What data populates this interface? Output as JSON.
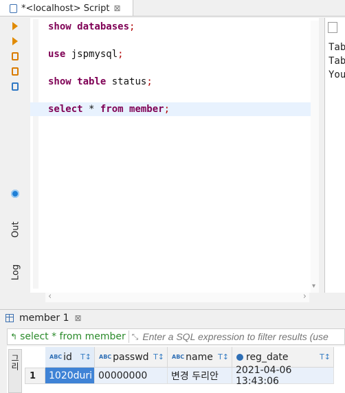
{
  "editor_tab": {
    "title": "*<localhost> Script",
    "close": "⊠"
  },
  "editor": {
    "lines": [
      {
        "kw": "show databases",
        "rest": "",
        "semi": ";"
      },
      {
        "kw": "use",
        "rest": " jspmysql",
        "semi": ";"
      },
      {
        "kw": "show table",
        "rest": " status",
        "semi": ";"
      },
      {
        "kw": "select",
        "rest": " * ",
        "kw2": "from member",
        "semi": ";"
      }
    ]
  },
  "side_tabs": {
    "out": "Out",
    "log": "Log"
  },
  "right_panel": {
    "lines": [
      "Tab",
      "Tab",
      "You"
    ]
  },
  "results_tab": {
    "title": "member 1",
    "close": "⊠"
  },
  "filter": {
    "query": "select * from member",
    "placeholder": "Enter a SQL expression to filter results (use"
  },
  "grid": {
    "side_label": "그리",
    "columns": [
      {
        "name": "id",
        "type": "ABC"
      },
      {
        "name": "passwd",
        "type": "ABC"
      },
      {
        "name": "name",
        "type": "ABC"
      },
      {
        "name": "reg_date",
        "type": "clock"
      }
    ],
    "rows": [
      {
        "num": "1",
        "cells": [
          "1020duri",
          "00000000",
          "변경 두리안",
          "2021-04-06 13:43:06"
        ]
      }
    ]
  }
}
